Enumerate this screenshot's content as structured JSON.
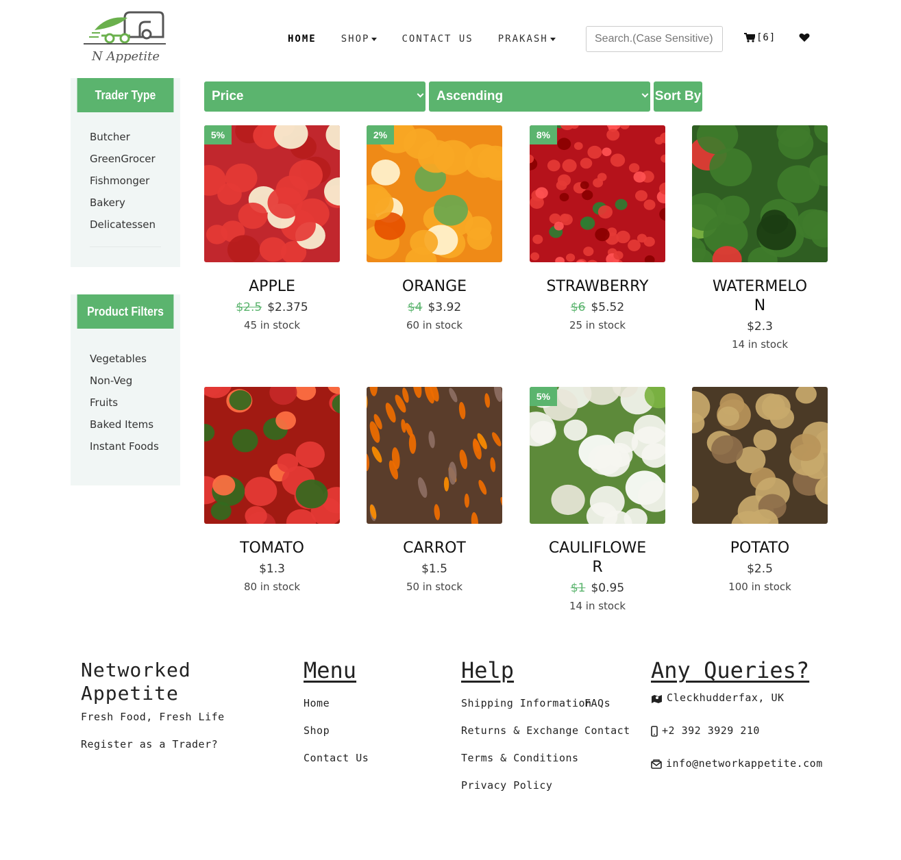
{
  "header": {
    "logo_text": "N Appetite",
    "nav": [
      {
        "label": "HOME",
        "active": true
      },
      {
        "label": "SHOP",
        "dropdown": true
      },
      {
        "label": "CONTACT US"
      },
      {
        "label": "PRAKASH",
        "dropdown": true
      }
    ],
    "search_placeholder": "Search.(Case Sensitive)",
    "cart_count": "[6]"
  },
  "sidebar": {
    "trader": {
      "title": "Trader Type",
      "items": [
        "Butcher",
        "GreenGrocer",
        "Fishmonger",
        "Bakery",
        "Delicatessen"
      ]
    },
    "filters": {
      "title": "Product Filters",
      "items": [
        "Vegetables",
        "Non-Veg",
        "Fruits",
        "Baked Items",
        "Instant Foods"
      ]
    }
  },
  "sort": {
    "field": "Price",
    "order": "Ascending",
    "button": "Sort By"
  },
  "products": [
    {
      "name": "APPLE",
      "discount": "5%",
      "old_price": "$2.5",
      "price": "$2.375",
      "stock": "45 in stock",
      "image": "apples"
    },
    {
      "name": "ORANGE",
      "discount": "2%",
      "old_price": "$4",
      "price": "$3.92",
      "stock": "60 in stock",
      "image": "oranges"
    },
    {
      "name": "STRAWBERRY",
      "discount": "8%",
      "old_price": "$6",
      "price": "$5.52",
      "stock": "25 in stock",
      "image": "strawberries"
    },
    {
      "name": "WATERMELON",
      "discount": "",
      "old_price": "",
      "price": "$2.3",
      "stock": "14 in stock",
      "image": "watermelons"
    },
    {
      "name": "TOMATO",
      "discount": "",
      "old_price": "",
      "price": "$1.3",
      "stock": "80 in stock",
      "image": "tomatoes"
    },
    {
      "name": "CARROT",
      "discount": "",
      "old_price": "",
      "price": "$1.5",
      "stock": "50 in stock",
      "image": "carrots"
    },
    {
      "name": "CAULIFLOWER",
      "discount": "5%",
      "old_price": "$1",
      "price": "$0.95",
      "stock": "14 in stock",
      "image": "cauliflowers"
    },
    {
      "name": "POTATO",
      "discount": "",
      "old_price": "",
      "price": "$2.5",
      "stock": "100 in stock",
      "image": "potatoes"
    }
  ],
  "footer": {
    "brand_line1": "Networked",
    "brand_line2": "Appetite",
    "tagline": "Fresh Food, Fresh Life",
    "register": "Register as a Trader?",
    "menu": {
      "title": "Menu",
      "items": [
        "Home",
        "Shop",
        "Contact Us"
      ]
    },
    "help": {
      "title": "Help",
      "col1": [
        "Shipping Information",
        "Returns & Exchange",
        "Terms & Conditions",
        "Privacy Policy"
      ],
      "col2": [
        "FAQs",
        "Contact"
      ]
    },
    "queries": {
      "title": "Any Queries?",
      "address": "Cleckhudderfax, UK",
      "phone": "+2 392 3929 210",
      "email": "info@networkappetite.com"
    }
  },
  "colors": {
    "accent": "#5bb46e",
    "sidebar_bg": "#f1f6f5"
  }
}
